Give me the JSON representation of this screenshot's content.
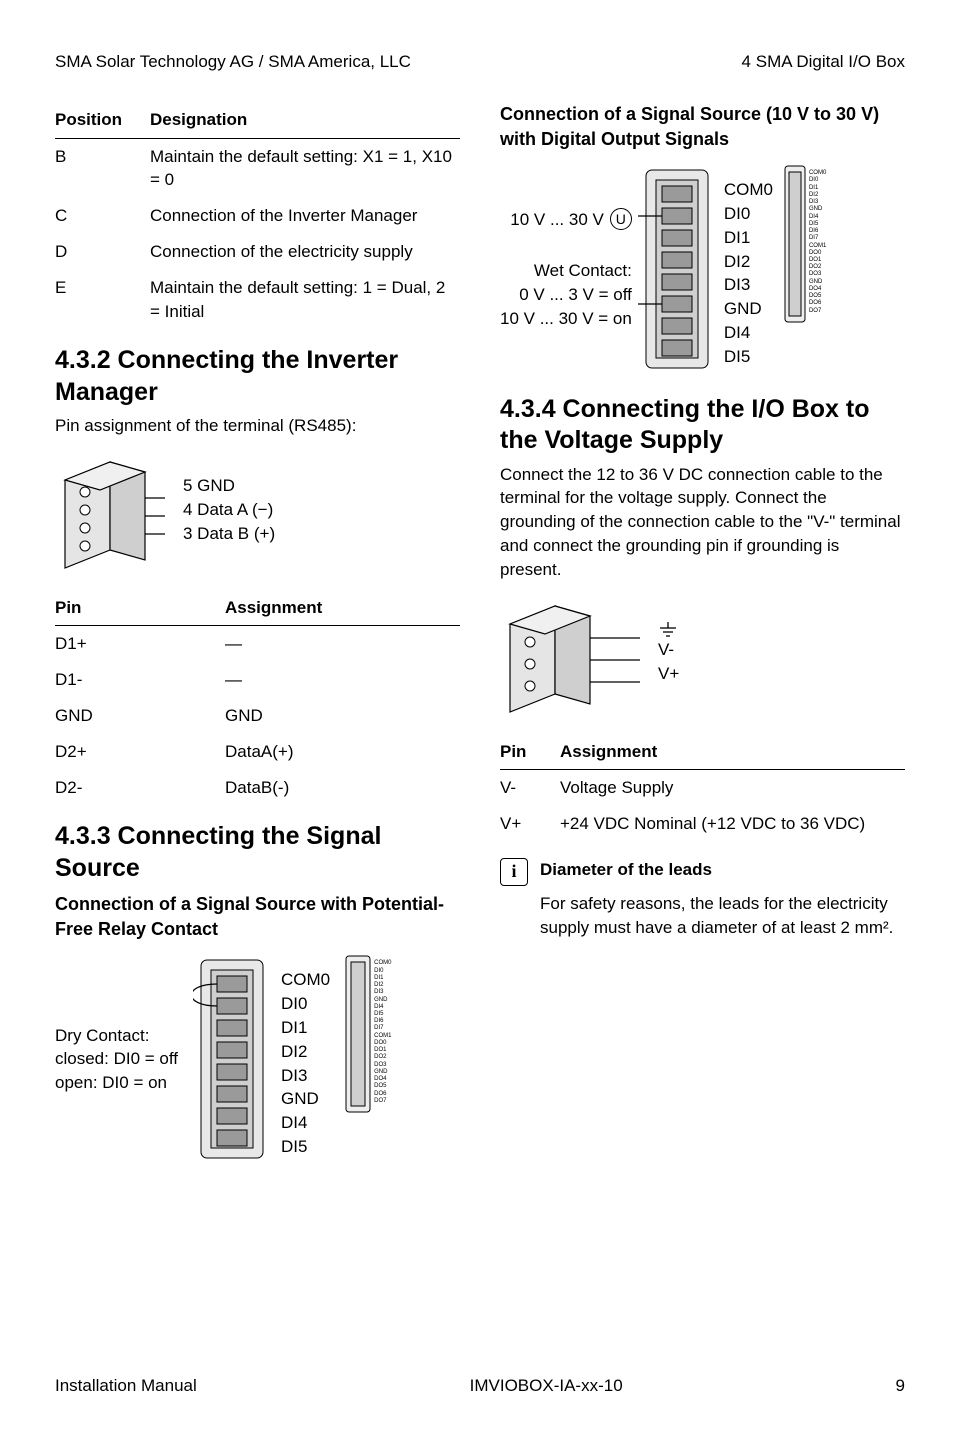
{
  "header": {
    "left": "SMA Solar Technology AG / SMA America, LLC",
    "right": "4   SMA Digital I/O Box"
  },
  "positions_table": {
    "head": [
      "Position",
      "Designation"
    ],
    "rows": [
      [
        "B",
        "Maintain the default setting: X1 = 1, X10 = 0"
      ],
      [
        "C",
        "Connection of the Inverter Manager"
      ],
      [
        "D",
        "Connection of the electricity supply"
      ],
      [
        "E",
        "Maintain the default setting: 1 = Dual, 2 = Initial"
      ]
    ]
  },
  "sec432": {
    "title": "4.3.2  Connecting the Inverter Manager",
    "sub": "Pin assignment of the terminal (RS485):",
    "pins": [
      "5 GND",
      "4 Data A (−)",
      "3 Data B (+)"
    ]
  },
  "pin_table": {
    "head": [
      "Pin",
      "Assignment"
    ],
    "rows": [
      [
        "D1+",
        "—"
      ],
      [
        "D1-",
        "—"
      ],
      [
        "GND",
        "GND"
      ],
      [
        "D2+",
        "DataA(+)"
      ],
      [
        "D2-",
        "DataB(-)"
      ]
    ]
  },
  "sec433": {
    "title": "4.3.3  Connecting the Signal Source",
    "sub1": "Connection of a Signal Source with Potential-Free Relay Contact",
    "dry_lines": [
      "Dry Contact:",
      "closed: DI0 = off",
      "open: DI0 = on"
    ],
    "term8": [
      "COM0",
      "DI0",
      "DI1",
      "DI2",
      "DI3",
      "GND",
      "DI4",
      "DI5"
    ],
    "tiny": [
      "COM0",
      "DI0",
      "DI1",
      "DI2",
      "DI3",
      "GND",
      "DI4",
      "DI5",
      "DI6",
      "DI7",
      "COM1",
      "DO0",
      "DO1",
      "DO2",
      "DO3",
      "GND",
      "DO4",
      "DO5",
      "DO6",
      "DO7"
    ]
  },
  "right_top": {
    "title": "Connection of a Signal Source (10 V to 30 V) with Digital Output Signals",
    "left_lines": [
      "10 V ... 30 V",
      "Wet Contact:",
      "0 V ... 3 V = off",
      "10 V ... 30 V = on"
    ],
    "term8": [
      "COM0",
      "DI0",
      "DI1",
      "DI2",
      "DI3",
      "GND",
      "DI4",
      "DI5"
    ],
    "tiny": [
      "COM0",
      "DI0",
      "DI1",
      "DI2",
      "DI3",
      "GND",
      "DI4",
      "DI5",
      "DI6",
      "DI7",
      "COM1",
      "DO0",
      "DO1",
      "DO2",
      "DO3",
      "GND",
      "DO4",
      "DO5",
      "DO6",
      "DO7"
    ]
  },
  "sec434": {
    "title": "4.3.4  Connecting the I/O Box to the Voltage Supply",
    "body": "Connect the 12 to 36 V DC connection cable to the terminal for the voltage supply. Connect the grounding of the connection cable to the \"V-\" terminal and connect the grounding pin if grounding is present.",
    "fig_labels": [
      "V-",
      "V+"
    ],
    "pin_head": [
      "Pin",
      "Assignment"
    ],
    "pin_rows": [
      [
        "V-",
        "Voltage Supply"
      ],
      [
        "V+",
        "+24 VDC Nominal (+12 VDC to 36 VDC)"
      ]
    ],
    "info_title": "Diameter of the leads",
    "info_body": "For safety reasons, the leads for the electricity supply must have a diameter of at least 2 mm²."
  },
  "footer": {
    "left": "Installation Manual",
    "center": "IMVIOBOX-IA-xx-10",
    "right": "9"
  }
}
